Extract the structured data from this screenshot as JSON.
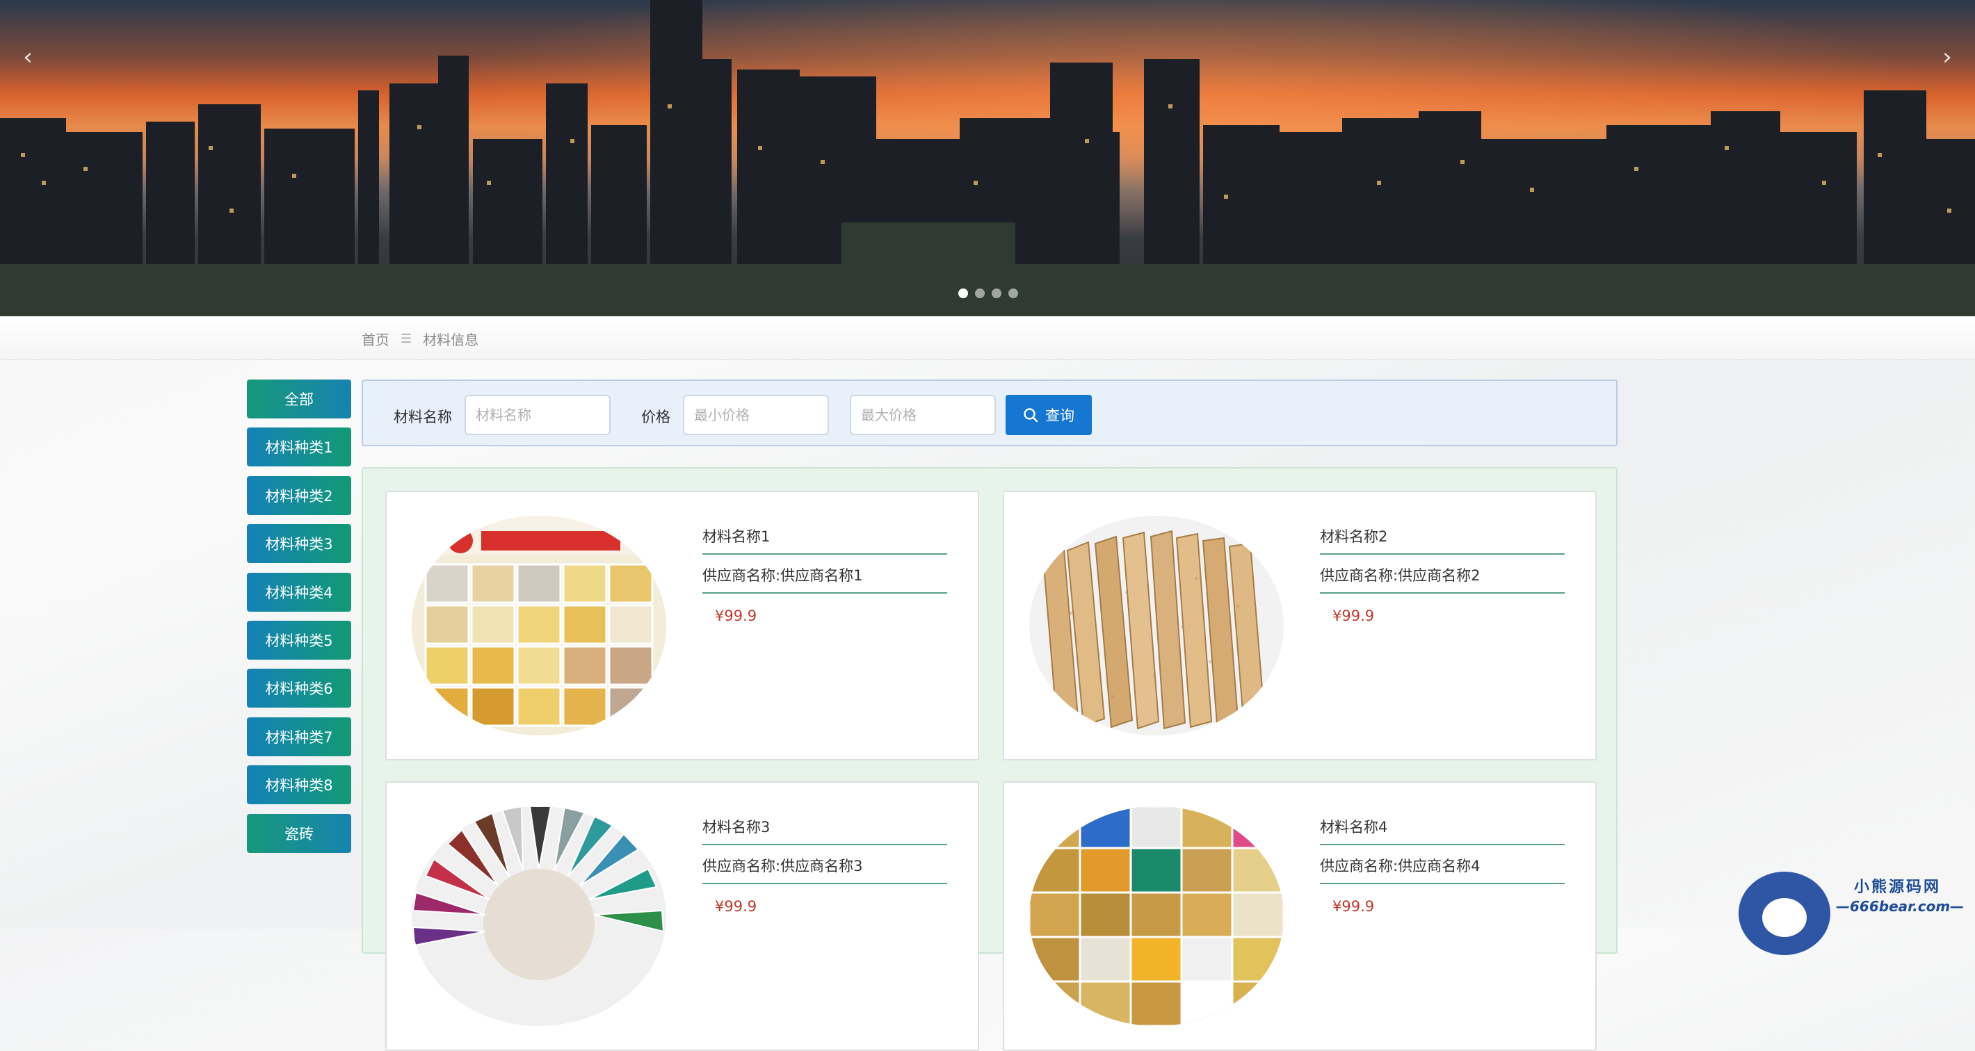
{
  "banner": {
    "prev_icon": "‹",
    "next_icon": "›",
    "slides": 4,
    "active_slide": 0
  },
  "breadcrumb": {
    "home": "首页",
    "separator": "☰",
    "current": "材料信息"
  },
  "categories": [
    "全部",
    "材料种类1",
    "材料种类2",
    "材料种类3",
    "材料种类4",
    "材料种类5",
    "材料种类6",
    "材料种类7",
    "材料种类8",
    "瓷砖"
  ],
  "search": {
    "name_label": "材料名称",
    "name_placeholder": "材料名称",
    "price_label": "价格",
    "min_placeholder": "最小价格",
    "max_placeholder": "最大价格",
    "button_label": "查询",
    "button_icon": "search-icon"
  },
  "items": [
    {
      "name": "材料名称1",
      "supplier": "供应商名称:供应商名称1",
      "price": "¥99.9",
      "image": "glazed-tile-swatches"
    },
    {
      "name": "材料名称2",
      "supplier": "供应商名称:供应商名称2",
      "price": "¥99.9",
      "image": "particle-board-stack"
    },
    {
      "name": "材料名称3",
      "supplier": "供应商名称:供应商名称3",
      "price": "¥99.9",
      "image": "color-fan-chart"
    },
    {
      "name": "材料名称4",
      "supplier": "供应商名称:供应商名称4",
      "price": "¥99.9",
      "image": "3d-wall-panels"
    }
  ],
  "logo": {
    "title": "小熊源码网",
    "subtitle": "—666bear.com—"
  }
}
